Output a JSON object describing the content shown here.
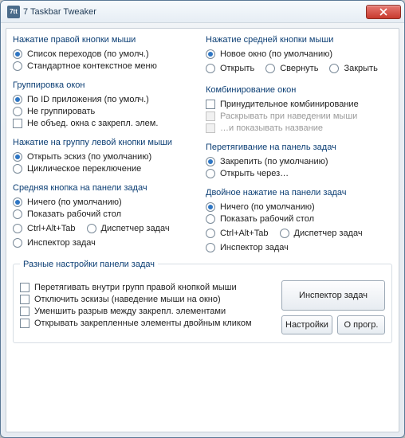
{
  "window": {
    "title": "7 Taskbar Tweaker",
    "icon_text": "7tt"
  },
  "left": {
    "g1": {
      "title": "Нажатие правой кнопки мыши",
      "opts": [
        {
          "label": "Список переходов (по умолч.)",
          "selected": true
        },
        {
          "label": "Стандартное контекстное меню",
          "selected": false
        }
      ]
    },
    "g2": {
      "title": "Группировка окон",
      "opts": [
        {
          "label": "По ID приложения (по умолч.)",
          "selected": true
        },
        {
          "label": "Не группировать",
          "selected": false
        }
      ],
      "check": {
        "label": "Не объед. окна с закрепл. элем."
      }
    },
    "g3": {
      "title": "Нажатие на группу левой кнопки мыши",
      "opts": [
        {
          "label": "Открыть эскиз (по умолчанию)",
          "selected": true
        },
        {
          "label": "Циклическое переключение",
          "selected": false
        }
      ]
    },
    "g4": {
      "title": "Средняя кнопка на панели задач",
      "opts": [
        {
          "label": "Ничего (по умолчанию)",
          "selected": true
        },
        {
          "label": "Показать рабочий стол",
          "selected": false
        },
        {
          "label": "Ctrl+Alt+Tab",
          "selected": false
        },
        {
          "label": "Диспетчер задач",
          "selected": false
        },
        {
          "label": "Инспектор задач",
          "selected": false
        }
      ]
    }
  },
  "right": {
    "g1": {
      "title": "Нажатие средней кнопки мыши",
      "opts": [
        {
          "label": "Новое окно (по умолчанию)",
          "selected": true
        },
        {
          "label": "Открыть",
          "selected": false
        },
        {
          "label": "Свернуть",
          "selected": false
        },
        {
          "label": "Закрыть",
          "selected": false
        }
      ]
    },
    "g2": {
      "title": "Комбинирование окон",
      "checks": [
        {
          "label": "Принудительное комбинирование",
          "disabled": false
        },
        {
          "label": "Раскрывать при наведении мыши",
          "disabled": true
        },
        {
          "label": "…и показывать название",
          "disabled": true
        }
      ]
    },
    "g3": {
      "title": "Перетягивание на панель задач",
      "opts": [
        {
          "label": "Закрепить (по умолчанию)",
          "selected": true
        },
        {
          "label": "Открыть через…",
          "selected": false
        }
      ]
    },
    "g4": {
      "title": "Двойное нажатие на панели задач",
      "opts": [
        {
          "label": "Ничего (по умолчанию)",
          "selected": true
        },
        {
          "label": "Показать рабочий стол",
          "selected": false
        },
        {
          "label": "Ctrl+Alt+Tab",
          "selected": false
        },
        {
          "label": "Диспетчер задач",
          "selected": false
        },
        {
          "label": "Инспектор задач",
          "selected": false
        }
      ]
    }
  },
  "bottom": {
    "title": "Разные настройки панели задач",
    "checks": [
      {
        "label": "Перетягивать внутри групп правой кнопкой мыши"
      },
      {
        "label": "Отключить эскизы (наведение мыши на окно)"
      },
      {
        "label": "Уменшить разрыв между закрепл. элементами"
      },
      {
        "label": "Открывать закрепленные элементы двойным кликом"
      }
    ],
    "buttons": {
      "inspector": "Инспектор задач",
      "settings": "Настройки",
      "about": "О прогр."
    }
  }
}
